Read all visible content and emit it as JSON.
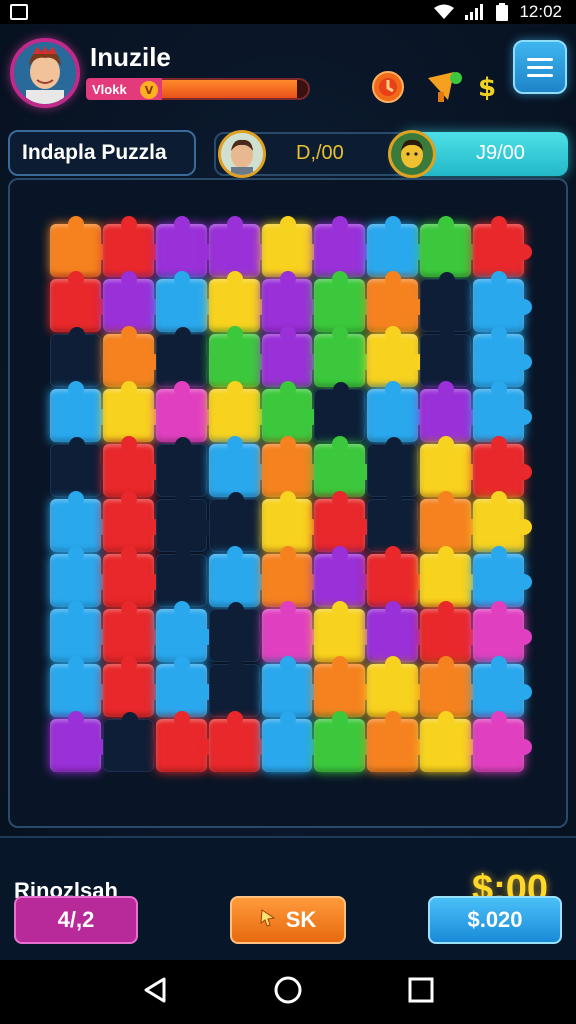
{
  "status_bar": {
    "time": "12:02",
    "icons": [
      "image-icon",
      "wifi-icon",
      "signal-icon",
      "battery-icon"
    ]
  },
  "header": {
    "app_title": "Inuzile",
    "level_label": "Vlokk",
    "level_badge": "V",
    "xp_progress": 0.95,
    "icons": [
      "timer-icon",
      "megaphone-icon",
      "dollar-icon",
      "menu-icon"
    ]
  },
  "puzzle": {
    "title": "Indapla Puzzla",
    "player_score": "D,/00",
    "opponent_score": "J9/00"
  },
  "bottom": {
    "label": "Rinozlsah",
    "amount": "$:00",
    "buttons": [
      {
        "label": "4/,2",
        "color": "#b82a9a"
      },
      {
        "label": "SK",
        "color": "#f07a1a",
        "icon": "cursor-icon"
      },
      {
        "label": "$.020",
        "color": "#2aa8e8"
      }
    ]
  },
  "colors": {
    "red": "#e8282a",
    "orange": "#f5821f",
    "yellow": "#f7d21e",
    "green": "#3cc83c",
    "blue": "#2aa8ee",
    "purple": "#9a30d8",
    "magenta": "#e040c0",
    "dark": "#0d1e36"
  },
  "board_grid": [
    [
      "orange",
      "red",
      "purple",
      "purple",
      "yellow",
      "purple",
      "blue",
      "green",
      "red"
    ],
    [
      "red",
      "purple",
      "blue",
      "yellow",
      "purple",
      "green",
      "orange",
      "dark",
      "blue"
    ],
    [
      "dark",
      "orange",
      "dark",
      "green",
      "purple",
      "green",
      "yellow",
      "dark",
      "blue"
    ],
    [
      "blue",
      "yellow",
      "magenta",
      "yellow",
      "green",
      "dark",
      "blue",
      "purple",
      "blue"
    ],
    [
      "dark",
      "red",
      "dark",
      "blue",
      "orange",
      "green",
      "dark",
      "yellow",
      "red"
    ],
    [
      "blue",
      "red",
      "dark",
      "dark",
      "yellow",
      "red",
      "dark",
      "orange",
      "yellow"
    ],
    [
      "blue",
      "red",
      "dark",
      "blue",
      "orange",
      "purple",
      "red",
      "yellow",
      "blue"
    ],
    [
      "blue",
      "red",
      "blue",
      "dark",
      "magenta",
      "yellow",
      "purple",
      "red",
      "magenta"
    ],
    [
      "blue",
      "red",
      "blue",
      "dark",
      "blue",
      "orange",
      "yellow",
      "orange",
      "blue"
    ],
    [
      "purple",
      "dark",
      "red",
      "red",
      "blue",
      "green",
      "orange",
      "yellow",
      "magenta"
    ]
  ]
}
